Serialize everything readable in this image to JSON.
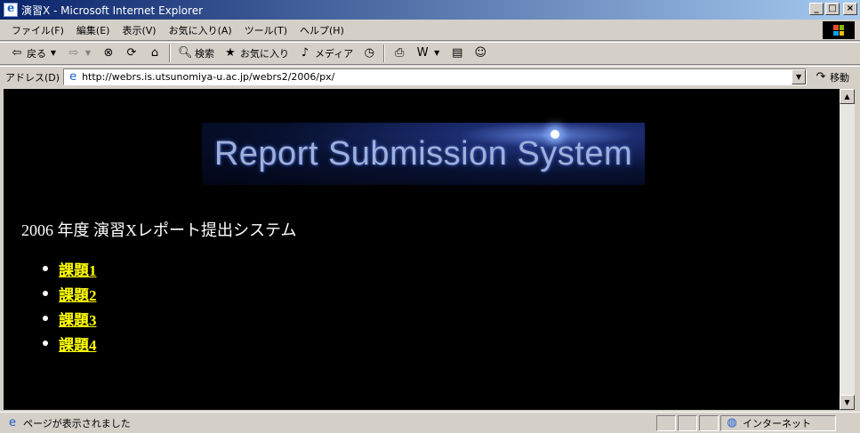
{
  "window": {
    "title": "演習X - Microsoft Internet Explorer"
  },
  "menu": [
    "ファイル(F)",
    "編集(E)",
    "表示(V)",
    "お気に入り(A)",
    "ツール(T)",
    "ヘルプ(H)"
  ],
  "toolbar": {
    "back": "戻る",
    "search": "検索",
    "favorites": "お気に入り",
    "media": "メディア"
  },
  "address": {
    "label": "アドレス(D)",
    "url": "http://webrs.is.utsunomiya-u.ac.jp/webrs2/2006/px/",
    "go": "移動"
  },
  "page": {
    "banner_text": "Report Submission System",
    "heading": "2006 年度 演習Xレポート提出システム",
    "tasks": [
      "課題1",
      "課題2",
      "課題3",
      "課題4"
    ],
    "link_color": "#ffff00",
    "background": "#000000"
  },
  "status": {
    "message": "ページが表示されました",
    "zone": "インターネット"
  }
}
